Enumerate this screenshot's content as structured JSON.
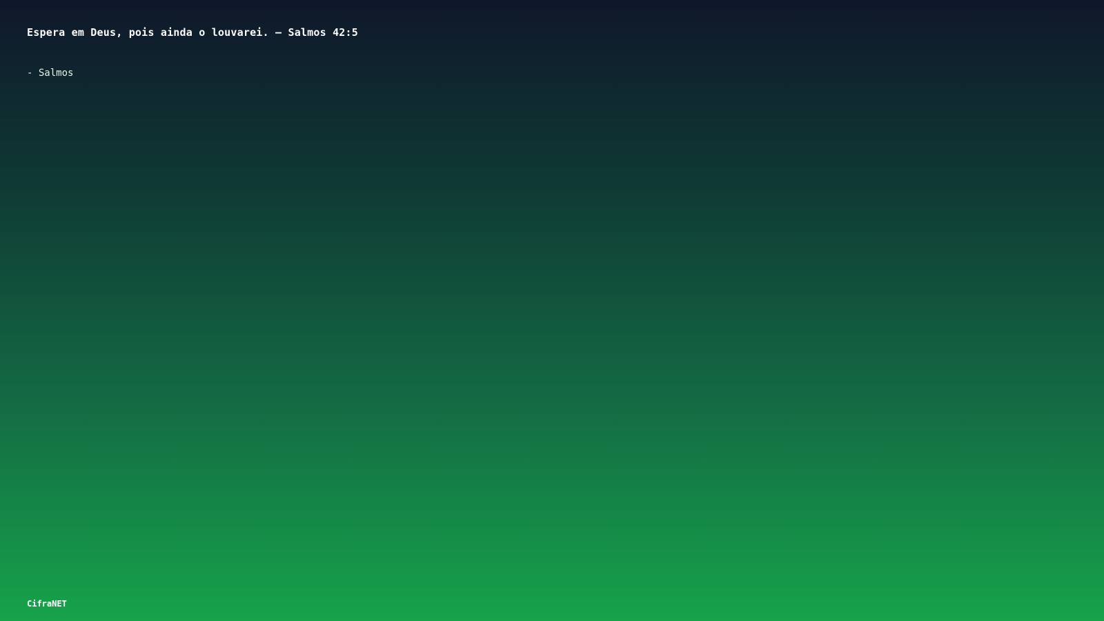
{
  "quote": {
    "text": "Espera em Deus, pois ainda o louvarei. – Salmos 42:5",
    "attribution": "- Salmos"
  },
  "footer": {
    "brand": "CifraNET"
  },
  "colors": {
    "gradient_top": "#0f172a",
    "gradient_bottom": "#16a34a",
    "text": "#ffffff"
  }
}
